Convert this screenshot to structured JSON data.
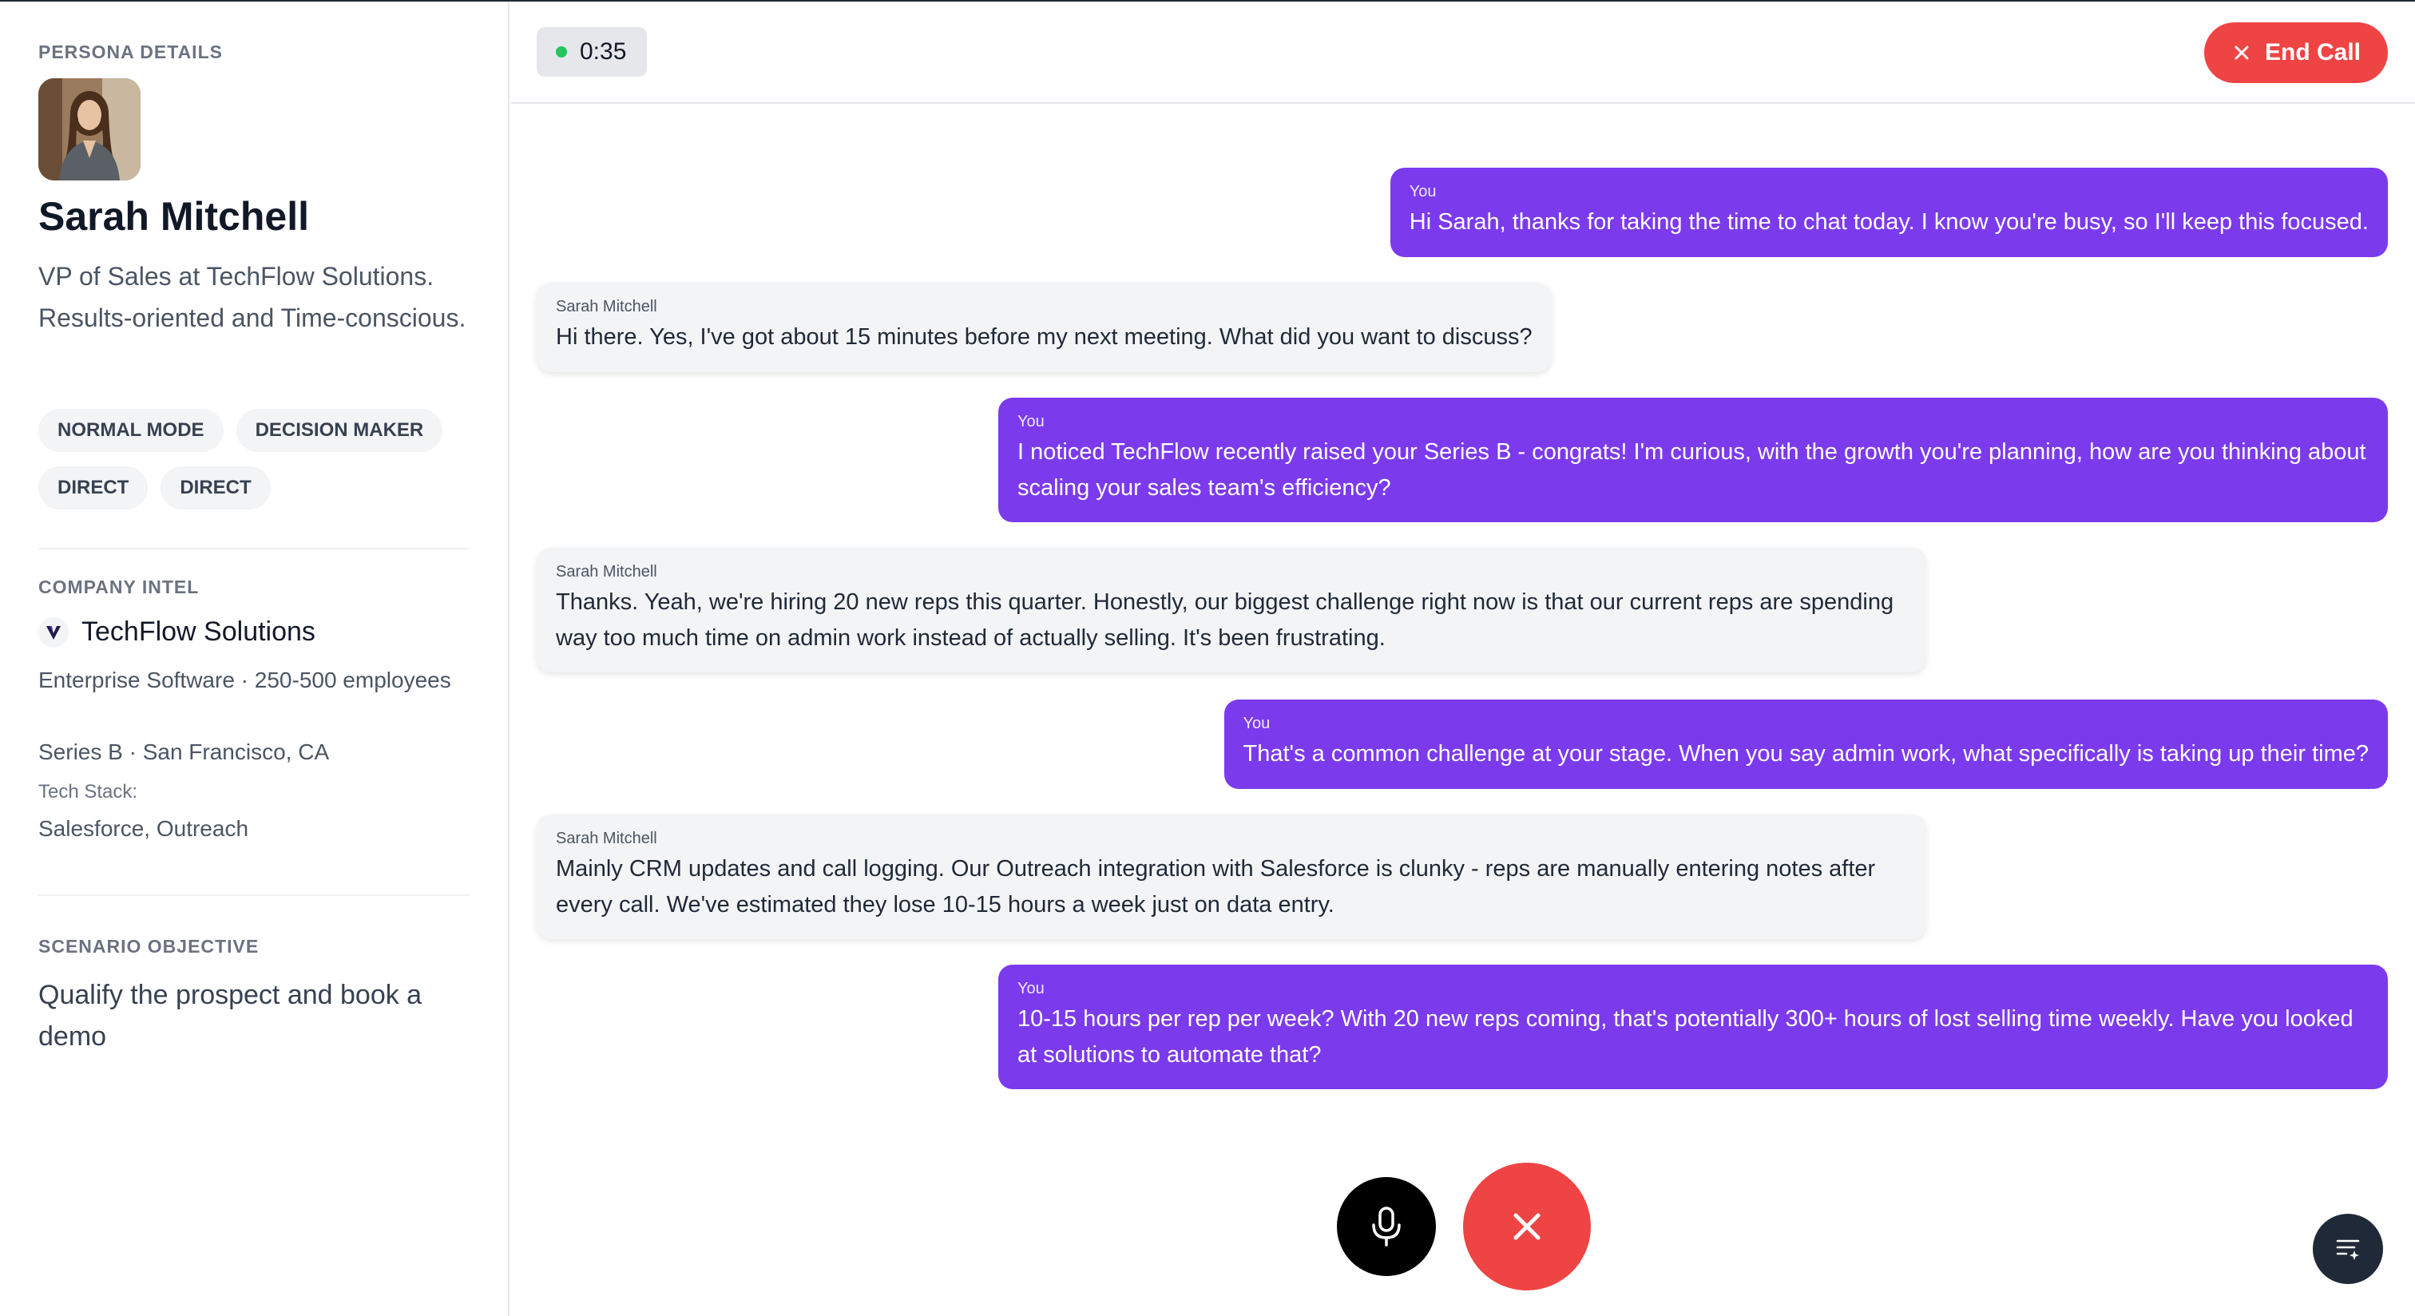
{
  "sidebar": {
    "persona_label": "PERSONA DETAILS",
    "name": "Sarah Mitchell",
    "description": "VP of Sales at TechFlow Solutions. Results-oriented and Time-conscious.",
    "tags": [
      "NORMAL MODE",
      "DECISION MAKER",
      "DIRECT",
      "DIRECT"
    ],
    "company_label": "COMPANY INTEL",
    "company_name": "TechFlow Solutions",
    "company_logo_icon": "v-logo-icon",
    "company_industry": "Enterprise Software · 250-500 employees",
    "company_funding": "Series B · San Francisco, CA",
    "tech_stack_label": "Tech Stack:",
    "tech_stack": "Salesforce, Outreach",
    "objective_label": "SCENARIO OBJECTIVE",
    "objective": "Qualify the prospect and book a demo"
  },
  "header": {
    "timer": "0:35",
    "timer_status_color": "#22c55e",
    "end_call_label": "End Call"
  },
  "messages": [
    {
      "speaker": "You",
      "text": "Hi Sarah, thanks for taking the time to chat today. I know you're busy, so I'll keep this focused."
    },
    {
      "speaker": "Sarah Mitchell",
      "text": "Hi there. Yes, I've got about 15 minutes before my next meeting. What did you want to discuss?"
    },
    {
      "speaker": "You",
      "text": "I noticed TechFlow recently raised your Series B - congrats! I'm curious, with the growth you're planning, how are you thinking about scaling your sales team's efficiency?"
    },
    {
      "speaker": "Sarah Mitchell",
      "text": "Thanks. Yeah, we're hiring 20 new reps this quarter. Honestly, our biggest challenge right now is that our current reps are spending way too much time on admin work instead of actually selling. It's been frustrating."
    },
    {
      "speaker": "You",
      "text": "That's a common challenge at your stage. When you say admin work, what specifically is taking up their time?"
    },
    {
      "speaker": "Sarah Mitchell",
      "text": "Mainly CRM updates and call logging. Our Outreach integration with Salesforce is clunky - reps are manually entering notes after every call. We've estimated they lose 10-15 hours a week just on data entry."
    },
    {
      "speaker": "You",
      "text": "10-15 hours per rep per week? With 20 new reps coming, that's potentially 300+ hours of lost selling time weekly. Have you looked at solutions to automate that?"
    }
  ],
  "controls": {
    "mic_icon": "microphone-icon",
    "hangup_icon": "close-icon",
    "transcript_icon": "transcript-icon"
  },
  "colors": {
    "accent_purple": "#7c3aed",
    "danger_red": "#ef4444",
    "bubble_gray": "#f3f4f6"
  }
}
